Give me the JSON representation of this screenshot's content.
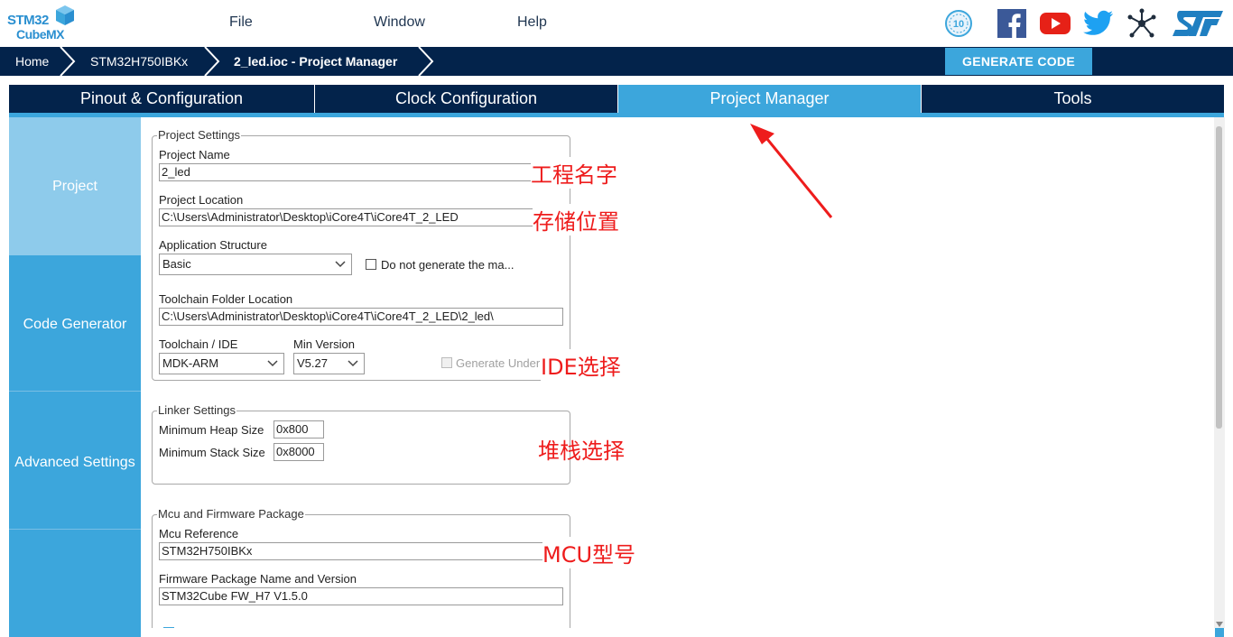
{
  "app": {
    "logo_line1": "STM32",
    "logo_line2": "CubeMX",
    "menu": [
      "File",
      "Window",
      "Help"
    ]
  },
  "social_icons": [
    "anniversary-10-icon",
    "facebook-icon",
    "youtube-icon",
    "twitter-icon",
    "network-share-icon",
    "st-logo-icon"
  ],
  "breadcrumb": {
    "items": [
      "Home",
      "STM32H750IBKx",
      "2_led.ioc - Project Manager"
    ]
  },
  "generate_button": "GENERATE CODE",
  "tabs": [
    "Pinout & Configuration",
    "Clock Configuration",
    "Project Manager",
    "Tools"
  ],
  "active_tab": "Project Manager",
  "sidenav": [
    "Project",
    "Code Generator",
    "Advanced Settings",
    ""
  ],
  "project_settings": {
    "title": "Project Settings",
    "name_label": "Project Name",
    "name_value": "2_led",
    "location_label": "Project Location",
    "location_value": "C:\\Users\\Administrator\\Desktop\\iCore4T\\iCore4T_2_LED",
    "structure_label": "Application Structure",
    "structure_value": "Basic",
    "no_main_label": "Do not generate the ma...",
    "toolchain_folder_label": "Toolchain Folder Location",
    "toolchain_folder_value": "C:\\Users\\Administrator\\Desktop\\iCore4T\\iCore4T_2_LED\\2_led\\",
    "ide_label": "Toolchain / IDE",
    "ide_value": "MDK-ARM",
    "min_version_label": "Min Version",
    "min_version_value": "V5.27",
    "generate_under_label": "Generate Under"
  },
  "linker_settings": {
    "title": "Linker Settings",
    "heap_label": "Minimum Heap Size",
    "heap_value": "0x800",
    "stack_label": "Minimum Stack Size",
    "stack_value": "0x8000"
  },
  "mcu_package": {
    "title": "Mcu and Firmware Package",
    "mcu_ref_label": "Mcu Reference",
    "mcu_ref_value": "STM32H750IBKx",
    "fw_label": "Firmware Package Name and Version",
    "fw_value": "STM32Cube FW_H7 V1.5.0"
  },
  "annotations": {
    "project_name": "工程名字",
    "location": "存储位置",
    "ide": "IDE选择",
    "stack": "堆栈选择",
    "mcu": "MCU型号"
  },
  "colors": {
    "navy": "#03234b",
    "accent": "#3ca6dc",
    "annotation_red": "#ee1c1c"
  }
}
